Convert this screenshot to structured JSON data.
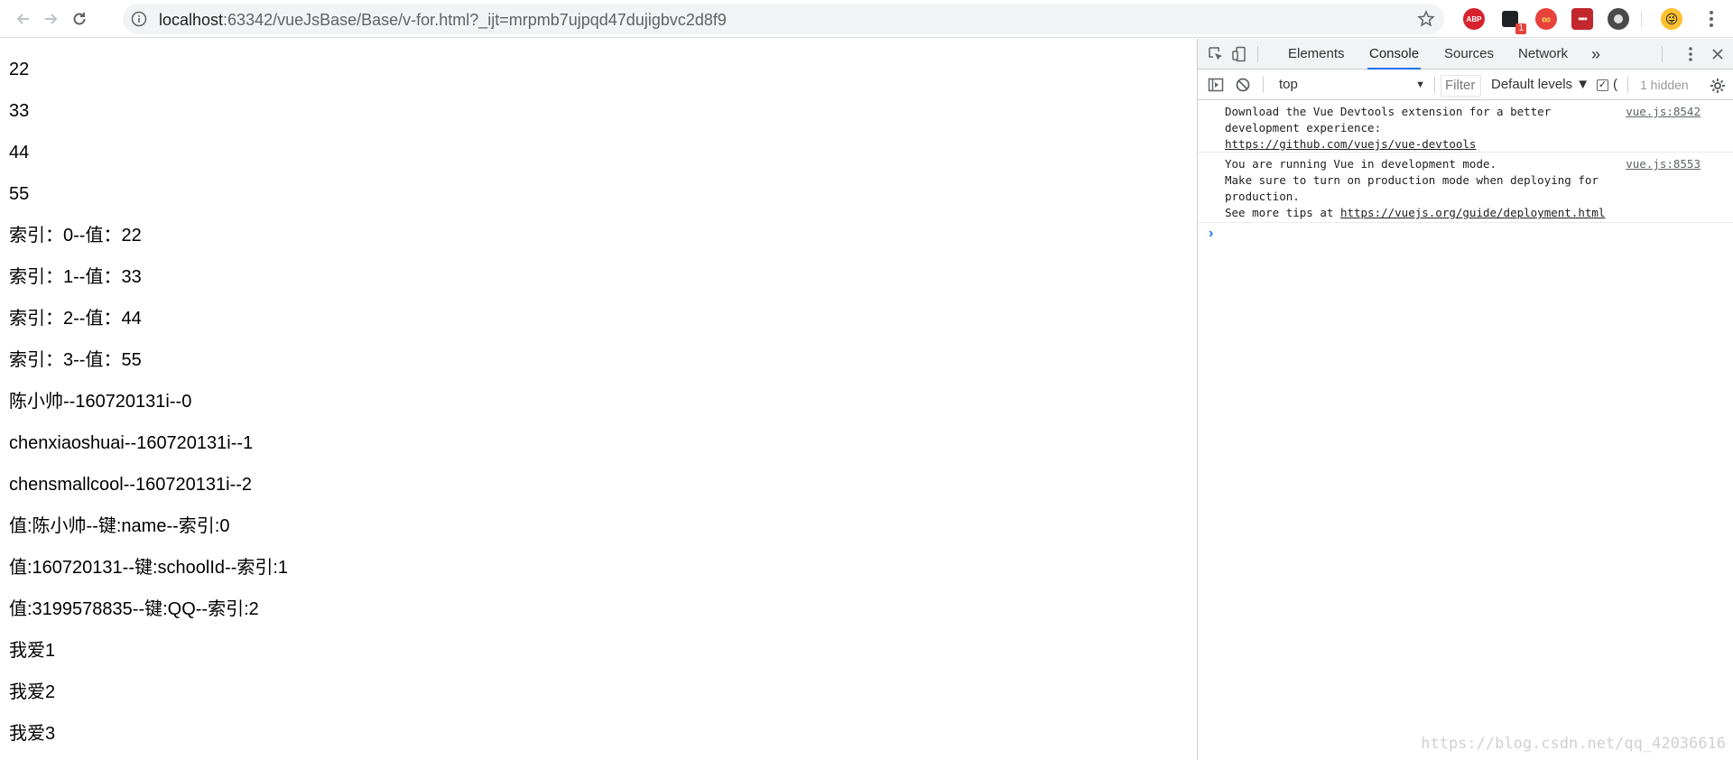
{
  "browser": {
    "url_host": "localhost",
    "url_rest": ":63342/vueJsBase/Base/v-for.html?_ijt=mrpmb7ujpqd47dujigbvc2d8f9",
    "extensions": [
      {
        "name": "adblock-plus",
        "label": "ABP"
      },
      {
        "name": "notifications",
        "badge": "1"
      },
      {
        "name": "infinity-new-tab",
        "label": "∞"
      },
      {
        "name": "lastpass",
        "label": "•••"
      },
      {
        "name": "ghostery",
        "label": ""
      }
    ]
  },
  "page": {
    "lines": [
      "22",
      "33",
      "44",
      "55",
      "索引：0--值：22",
      "索引：1--值：33",
      "索引：2--值：44",
      "索引：3--值：55",
      "陈小帅--160720131i--0",
      "chenxiaoshuai--160720131i--1",
      "chensmallcool--160720131i--2",
      "值:陈小帅--键:name--索引:0",
      "值:160720131--键:schoolId--索引:1",
      "值:3199578835--键:QQ--索引:2",
      "我爱1",
      "我爱2",
      "我爱3"
    ]
  },
  "devtools": {
    "tabs": [
      "Elements",
      "Console",
      "Sources",
      "Network"
    ],
    "active_tab": "Console",
    "more_tabs": "»",
    "context": "top",
    "filter_placeholder": "Filter",
    "levels": "Default levels ▼",
    "checkbox_label": "(",
    "hidden_count": "1 hidden",
    "messages": [
      {
        "line1": "Download the Vue Devtools extension for a better",
        "line2": "development experience:",
        "link": "https://github.com/vuejs/vue-devtools",
        "source": "vue.js:8542"
      },
      {
        "line1": "You are running Vue in development mode.",
        "line2": "Make sure to turn on production mode when deploying for",
        "line3": "production.",
        "line4_prefix": "See more tips at ",
        "link": "https://vuejs.org/guide/deployment.html",
        "source": "vue.js:8553"
      }
    ],
    "prompt_symbol": "›"
  },
  "watermark": "https://blog.csdn.net/qq_42036616",
  "colors": {
    "accent": "#1a73e8",
    "toolbar_bg": "#f1f3f4",
    "text": "#202124"
  }
}
